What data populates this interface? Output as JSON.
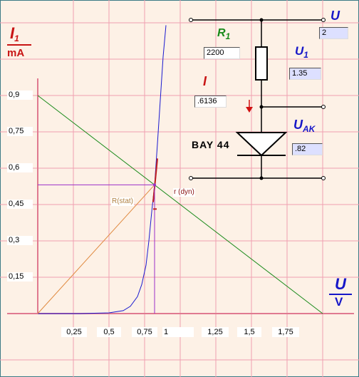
{
  "chart_data": {
    "type": "line",
    "ylabel": "I1",
    "yunit": "mA",
    "xlabel": "U",
    "xunit": "V",
    "xlim": [
      0,
      1.94
    ],
    "ylim": [
      0,
      1.05
    ],
    "x_ticks": [
      "0,25",
      "0,5",
      "0,75",
      "1",
      "1,25",
      "1,5",
      "1,75"
    ],
    "y_ticks": [
      "0,9",
      "0,75",
      "0,6",
      "0,45",
      "0,3",
      "0,15"
    ],
    "series": [
      {
        "kind": "diode-characteristic",
        "color": "#1a1ad0",
        "points": [
          [
            0.0,
            0.0
          ],
          [
            0.3,
            0.0
          ],
          [
            0.5,
            0.003
          ],
          [
            0.6,
            0.012
          ],
          [
            0.65,
            0.03
          ],
          [
            0.7,
            0.07
          ],
          [
            0.73,
            0.12
          ],
          [
            0.76,
            0.2
          ],
          [
            0.78,
            0.3
          ],
          [
            0.8,
            0.42
          ],
          [
            0.82,
            0.53
          ],
          [
            0.84,
            0.7
          ],
          [
            0.86,
            0.88
          ],
          [
            0.88,
            1.06
          ],
          [
            0.9,
            1.19
          ]
        ]
      },
      {
        "kind": "load-line",
        "color": "#1a8a1a",
        "points": [
          [
            0.0,
            0.9
          ],
          [
            2.0,
            0.0
          ]
        ]
      },
      {
        "kind": "static-resistance",
        "color": "#e08a40",
        "points": [
          [
            0.0,
            0.0
          ],
          [
            0.82,
            0.5314
          ]
        ]
      },
      {
        "kind": "dynamic-tangent",
        "color": "#c02020",
        "points": [
          [
            0.81,
            0.46
          ],
          [
            0.84,
            0.64
          ]
        ]
      }
    ],
    "operating_point": {
      "u": 0.82,
      "i": 0.5314
    }
  },
  "labels": {
    "r_stat": "R(stat)",
    "r_dyn": "r (dyn)"
  },
  "circuit": {
    "r1_label": "R",
    "r1_sub": "1",
    "r1_value": "2200",
    "u_label": "U",
    "u_value": "2",
    "u1_label": "U",
    "u1_sub": "1",
    "u1_value": "1.35",
    "i_label": "I",
    "i_value": ".6136",
    "uak_label": "U",
    "uak_sub": "AK",
    "uak_value": ".82",
    "diode_name": "BAY 44"
  },
  "axes": {
    "y_label": "I",
    "y_sub": "1",
    "y_unit": "mA",
    "x_label": "U",
    "x_unit": "V"
  },
  "colors": {
    "grid": "#f0a0b0",
    "background": "#fdf1e6",
    "frame": "#3c7a86"
  }
}
